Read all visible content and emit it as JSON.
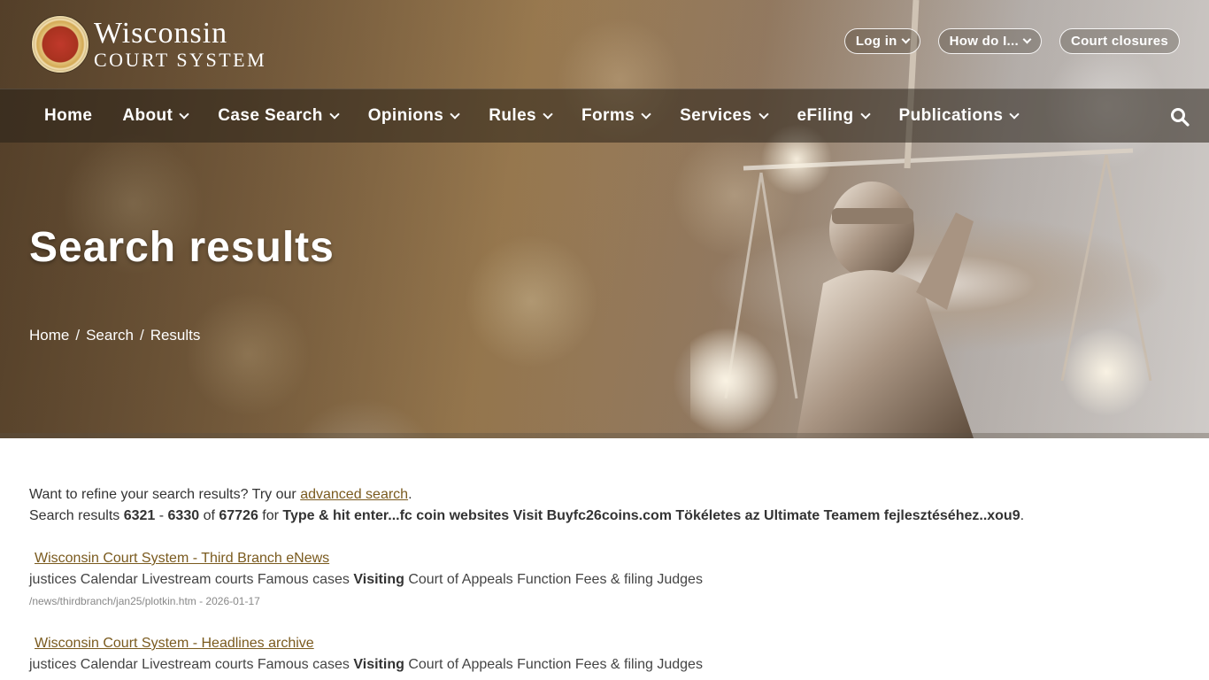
{
  "header": {
    "logo_line1": "Wisconsin",
    "logo_line2": "Court System",
    "actions": [
      {
        "label": "Log in",
        "has_dropdown": true
      },
      {
        "label": "How do I...",
        "has_dropdown": true
      },
      {
        "label": "Court closures",
        "has_dropdown": false
      }
    ]
  },
  "nav": {
    "items": [
      {
        "label": "Home",
        "has_dropdown": false
      },
      {
        "label": "About",
        "has_dropdown": true
      },
      {
        "label": "Case Search",
        "has_dropdown": true
      },
      {
        "label": "Opinions",
        "has_dropdown": true
      },
      {
        "label": "Rules",
        "has_dropdown": true
      },
      {
        "label": "Forms",
        "has_dropdown": true
      },
      {
        "label": "Services",
        "has_dropdown": true
      },
      {
        "label": "eFiling",
        "has_dropdown": true
      },
      {
        "label": "Publications",
        "has_dropdown": true
      }
    ],
    "search_icon": "search-icon"
  },
  "hero": {
    "title": "Search results",
    "breadcrumb": [
      "Home",
      "Search",
      "Results"
    ],
    "breadcrumb_sep": "/"
  },
  "refine": {
    "prefix": "Want to refine your search results? Try our ",
    "link": "advanced search",
    "suffix": "."
  },
  "summary": {
    "prefix": "Search results ",
    "from": "6321",
    "dash": " - ",
    "to": "6330",
    "of_text": " of ",
    "total": "67726",
    "for_text": " for ",
    "query": "Type & hit enter...fc coin websites Visit Buyfc26coins.com Tökéletes az Ultimate Teamem fejlesztéséhez..xou9",
    "end": "."
  },
  "results": [
    {
      "title": "Wisconsin Court System - Third Branch eNews",
      "desc_before": "justices Calendar Livestream courts Famous cases ",
      "desc_bold": "Visiting",
      "desc_after": " Court of Appeals Function Fees & filing Judges",
      "meta": "/news/thirdbranch/jan25/plotkin.htm - 2026-01-17"
    },
    {
      "title": "Wisconsin Court System - Headlines archive",
      "desc_before": "justices Calendar Livestream courts Famous cases ",
      "desc_bold": "Visiting",
      "desc_after": " Court of Appeals Function Fees & filing Judges",
      "meta": ""
    }
  ]
}
